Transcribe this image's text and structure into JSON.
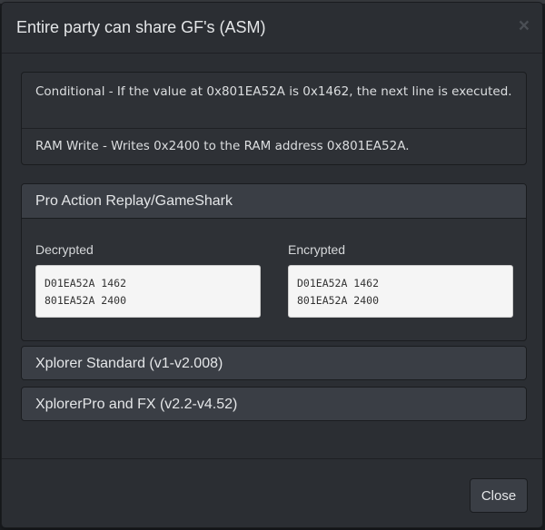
{
  "modal": {
    "title": "Entire party can share GF's (ASM)",
    "close_icon": "×"
  },
  "descriptions": [
    "Conditional - If the value at 0x801EA52A is 0x1462, the next line is executed.",
    "RAM Write - Writes 0x2400 to the RAM address 0x801EA52A."
  ],
  "panels": {
    "action_replay": {
      "title": "Pro Action Replay/GameShark",
      "decrypted_label": "Decrypted",
      "decrypted_code": "D01EA52A 1462\n801EA52A 2400",
      "encrypted_label": "Encrypted",
      "encrypted_code": "D01EA52A 1462\n801EA52A 2400"
    },
    "xplorer_standard": {
      "title": "Xplorer Standard (v1-v2.008)"
    },
    "xplorer_pro": {
      "title": "XplorerPro and FX (v2.2-v4.52)"
    }
  },
  "footer": {
    "close_label": "Close"
  }
}
